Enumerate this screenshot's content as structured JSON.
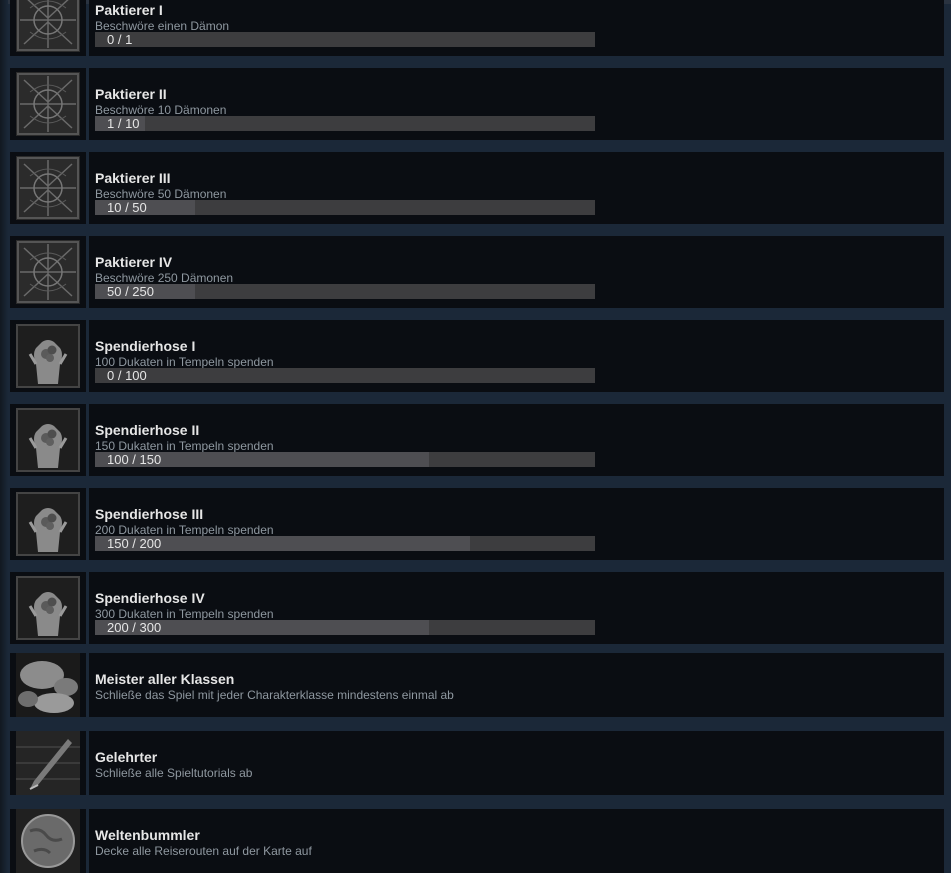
{
  "achievements": [
    {
      "title": "Paktierer I",
      "description": "Beschwöre einen Dämon",
      "progress_text": "0 / 1",
      "progress": 0.0,
      "icon": "demon-pact-icon"
    },
    {
      "title": "Paktierer II",
      "description": "Beschwöre 10 Dämonen",
      "progress_text": "1 / 10",
      "progress": 0.1,
      "icon": "demon-pact-icon"
    },
    {
      "title": "Paktierer III",
      "description": "Beschwöre 50 Dämonen",
      "progress_text": "10 / 50",
      "progress": 0.2,
      "icon": "demon-pact-icon"
    },
    {
      "title": "Paktierer IV",
      "description": "Beschwöre 250 Dämonen",
      "progress_text": "50 / 250",
      "progress": 0.2,
      "icon": "demon-pact-icon"
    },
    {
      "title": "Spendierhose I",
      "description": "100 Dukaten in Tempeln spenden",
      "progress_text": "0 / 100",
      "progress": 0.0,
      "icon": "coins-in-hand-icon"
    },
    {
      "title": "Spendierhose II",
      "description": "150 Dukaten in Tempeln spenden",
      "progress_text": "100 / 150",
      "progress": 0.667,
      "icon": "coins-in-hand-icon"
    },
    {
      "title": "Spendierhose III",
      "description": "200 Dukaten in Tempeln spenden",
      "progress_text": "150 / 200",
      "progress": 0.75,
      "icon": "coins-in-hand-icon"
    },
    {
      "title": "Spendierhose IV",
      "description": "300 Dukaten in Tempeln spenden",
      "progress_text": "200 / 300",
      "progress": 0.667,
      "icon": "coins-in-hand-icon"
    },
    {
      "title": "Meister aller Klassen",
      "description": "Schließe das Spiel mit jeder Charakterklasse mindestens einmal ab",
      "icon": "stones-icon"
    },
    {
      "title": "Gelehrter",
      "description": "Schließe alle Spieltutorials ab",
      "icon": "quill-icon"
    },
    {
      "title": "Weltenbummler",
      "description": "Decke alle Reiserouten auf der Karte auf",
      "icon": "globe-icon"
    }
  ],
  "colors": {
    "background": "#1b2838",
    "row": "#0a0d12",
    "title": "#e6e6e6",
    "description": "#8f98a0",
    "progress_track": "#3d3d3f"
  }
}
